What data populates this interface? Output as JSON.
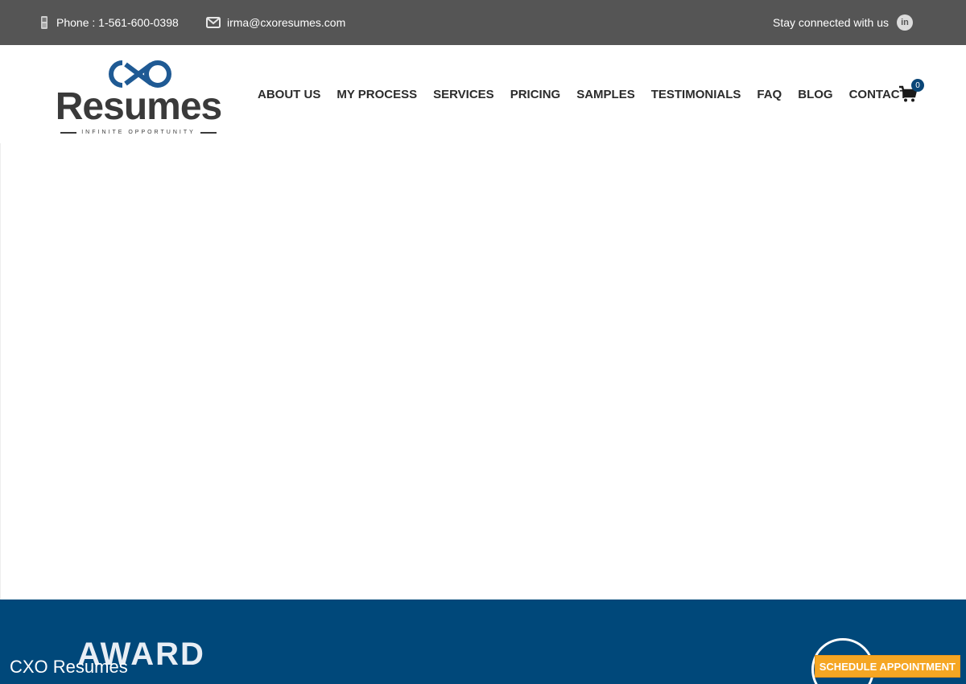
{
  "topbar": {
    "phone": "Phone : 1-561-600-0398",
    "email": "irma@cxoresumes.com",
    "social_label": "Stay connected with us",
    "social_icon": "linkedin-icon",
    "social_glyph": "in"
  },
  "logo": {
    "mark": "CXO",
    "word": "Resumes",
    "tagline": "INFINITE OPPORTUNITY",
    "colors": {
      "mark": "#1f5a94",
      "word": "#3a3a3a"
    }
  },
  "nav": {
    "items": [
      {
        "label": "ABOUT US"
      },
      {
        "label": "MY PROCESS"
      },
      {
        "label": "SERVICES"
      },
      {
        "label": "PRICING"
      },
      {
        "label": "SAMPLES"
      },
      {
        "label": "TESTIMONIALS"
      },
      {
        "label": "FAQ"
      },
      {
        "label": "BLOG"
      },
      {
        "label": "CONTACT"
      }
    ],
    "cart_count": "0"
  },
  "footer": {
    "heading_partial": "AWARD"
  },
  "sticky": {
    "title": "CXO Resumes",
    "button": "SCHEDULE APPOINTMENT"
  },
  "colors": {
    "topbar": "#555555",
    "brand_blue": "#00487a",
    "accent_orange": "#f5a623"
  }
}
